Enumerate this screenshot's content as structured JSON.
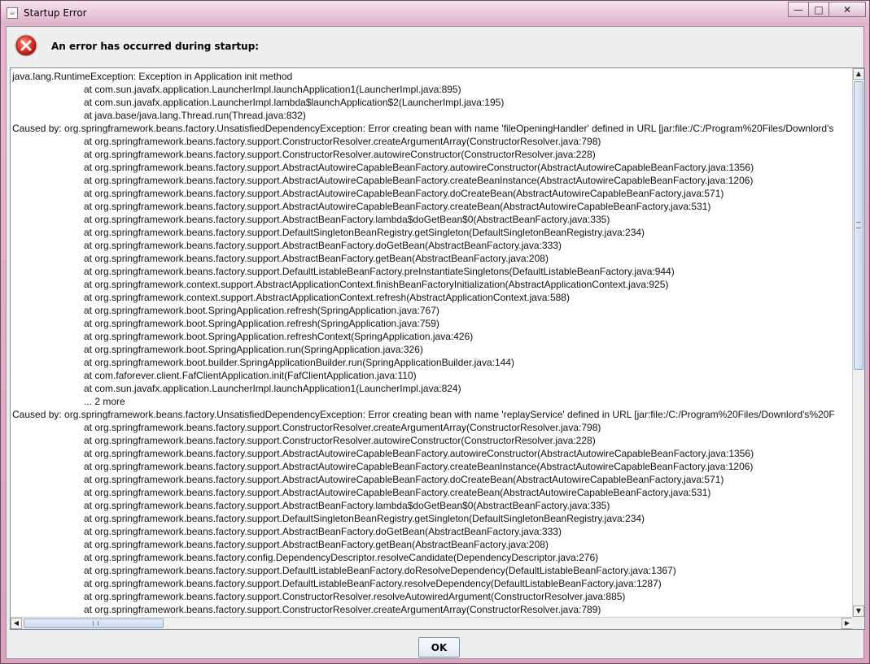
{
  "window": {
    "title": "Startup Error",
    "minimize_label": "—",
    "maximize_label": "□",
    "close_label": "✕"
  },
  "dialog": {
    "message": "An error has occurred during startup:",
    "ok_label": "OK"
  },
  "stacktrace": [
    {
      "text": "java.lang.RuntimeException: Exception in Application init method",
      "indent": false
    },
    {
      "text": "at com.sun.javafx.application.LauncherImpl.launchApplication1(LauncherImpl.java:895)",
      "indent": true
    },
    {
      "text": "at com.sun.javafx.application.LauncherImpl.lambda$launchApplication$2(LauncherImpl.java:195)",
      "indent": true
    },
    {
      "text": "at java.base/java.lang.Thread.run(Thread.java:832)",
      "indent": true
    },
    {
      "text": "Caused by: org.springframework.beans.factory.UnsatisfiedDependencyException: Error creating bean with name 'fileOpeningHandler' defined in URL [jar:file:/C:/Program%20Files/Downlord's",
      "indent": false
    },
    {
      "text": "at org.springframework.beans.factory.support.ConstructorResolver.createArgumentArray(ConstructorResolver.java:798)",
      "indent": true
    },
    {
      "text": "at org.springframework.beans.factory.support.ConstructorResolver.autowireConstructor(ConstructorResolver.java:228)",
      "indent": true
    },
    {
      "text": "at org.springframework.beans.factory.support.AbstractAutowireCapableBeanFactory.autowireConstructor(AbstractAutowireCapableBeanFactory.java:1356)",
      "indent": true
    },
    {
      "text": "at org.springframework.beans.factory.support.AbstractAutowireCapableBeanFactory.createBeanInstance(AbstractAutowireCapableBeanFactory.java:1206)",
      "indent": true
    },
    {
      "text": "at org.springframework.beans.factory.support.AbstractAutowireCapableBeanFactory.doCreateBean(AbstractAutowireCapableBeanFactory.java:571)",
      "indent": true
    },
    {
      "text": "at org.springframework.beans.factory.support.AbstractAutowireCapableBeanFactory.createBean(AbstractAutowireCapableBeanFactory.java:531)",
      "indent": true
    },
    {
      "text": "at org.springframework.beans.factory.support.AbstractBeanFactory.lambda$doGetBean$0(AbstractBeanFactory.java:335)",
      "indent": true
    },
    {
      "text": "at org.springframework.beans.factory.support.DefaultSingletonBeanRegistry.getSingleton(DefaultSingletonBeanRegistry.java:234)",
      "indent": true
    },
    {
      "text": "at org.springframework.beans.factory.support.AbstractBeanFactory.doGetBean(AbstractBeanFactory.java:333)",
      "indent": true
    },
    {
      "text": "at org.springframework.beans.factory.support.AbstractBeanFactory.getBean(AbstractBeanFactory.java:208)",
      "indent": true
    },
    {
      "text": "at org.springframework.beans.factory.support.DefaultListableBeanFactory.preInstantiateSingletons(DefaultListableBeanFactory.java:944)",
      "indent": true
    },
    {
      "text": "at org.springframework.context.support.AbstractApplicationContext.finishBeanFactoryInitialization(AbstractApplicationContext.java:925)",
      "indent": true
    },
    {
      "text": "at org.springframework.context.support.AbstractApplicationContext.refresh(AbstractApplicationContext.java:588)",
      "indent": true
    },
    {
      "text": "at org.springframework.boot.SpringApplication.refresh(SpringApplication.java:767)",
      "indent": true
    },
    {
      "text": "at org.springframework.boot.SpringApplication.refresh(SpringApplication.java:759)",
      "indent": true
    },
    {
      "text": "at org.springframework.boot.SpringApplication.refreshContext(SpringApplication.java:426)",
      "indent": true
    },
    {
      "text": "at org.springframework.boot.SpringApplication.run(SpringApplication.java:326)",
      "indent": true
    },
    {
      "text": "at org.springframework.boot.builder.SpringApplicationBuilder.run(SpringApplicationBuilder.java:144)",
      "indent": true
    },
    {
      "text": "at com.faforever.client.FafClientApplication.init(FafClientApplication.java:110)",
      "indent": true
    },
    {
      "text": "at com.sun.javafx.application.LauncherImpl.launchApplication1(LauncherImpl.java:824)",
      "indent": true
    },
    {
      "text": "... 2 more",
      "indent": true
    },
    {
      "text": "Caused by: org.springframework.beans.factory.UnsatisfiedDependencyException: Error creating bean with name 'replayService' defined in URL [jar:file:/C:/Program%20Files/Downlord's%20F",
      "indent": false
    },
    {
      "text": "at org.springframework.beans.factory.support.ConstructorResolver.createArgumentArray(ConstructorResolver.java:798)",
      "indent": true
    },
    {
      "text": "at org.springframework.beans.factory.support.ConstructorResolver.autowireConstructor(ConstructorResolver.java:228)",
      "indent": true
    },
    {
      "text": "at org.springframework.beans.factory.support.AbstractAutowireCapableBeanFactory.autowireConstructor(AbstractAutowireCapableBeanFactory.java:1356)",
      "indent": true
    },
    {
      "text": "at org.springframework.beans.factory.support.AbstractAutowireCapableBeanFactory.createBeanInstance(AbstractAutowireCapableBeanFactory.java:1206)",
      "indent": true
    },
    {
      "text": "at org.springframework.beans.factory.support.AbstractAutowireCapableBeanFactory.doCreateBean(AbstractAutowireCapableBeanFactory.java:571)",
      "indent": true
    },
    {
      "text": "at org.springframework.beans.factory.support.AbstractAutowireCapableBeanFactory.createBean(AbstractAutowireCapableBeanFactory.java:531)",
      "indent": true
    },
    {
      "text": "at org.springframework.beans.factory.support.AbstractBeanFactory.lambda$doGetBean$0(AbstractBeanFactory.java:335)",
      "indent": true
    },
    {
      "text": "at org.springframework.beans.factory.support.DefaultSingletonBeanRegistry.getSingleton(DefaultSingletonBeanRegistry.java:234)",
      "indent": true
    },
    {
      "text": "at org.springframework.beans.factory.support.AbstractBeanFactory.doGetBean(AbstractBeanFactory.java:333)",
      "indent": true
    },
    {
      "text": "at org.springframework.beans.factory.support.AbstractBeanFactory.getBean(AbstractBeanFactory.java:208)",
      "indent": true
    },
    {
      "text": "at org.springframework.beans.factory.config.DependencyDescriptor.resolveCandidate(DependencyDescriptor.java:276)",
      "indent": true
    },
    {
      "text": "at org.springframework.beans.factory.support.DefaultListableBeanFactory.doResolveDependency(DefaultListableBeanFactory.java:1367)",
      "indent": true
    },
    {
      "text": "at org.springframework.beans.factory.support.DefaultListableBeanFactory.resolveDependency(DefaultListableBeanFactory.java:1287)",
      "indent": true
    },
    {
      "text": "at org.springframework.beans.factory.support.ConstructorResolver.resolveAutowiredArgument(ConstructorResolver.java:885)",
      "indent": true
    },
    {
      "text": "at org.springframework.beans.factory.support.ConstructorResolver.createArgumentArray(ConstructorResolver.java:789)",
      "indent": true
    }
  ],
  "icons": {
    "app": "java-cup-icon",
    "error": "error-x-icon",
    "scroll_up": "▲",
    "scroll_down": "▼",
    "scroll_left": "◀",
    "scroll_right": "▶"
  },
  "colors": {
    "error_red": "#d9342b",
    "frame_pink": "#e9c4d8",
    "dialog_bg": "#eeeeee"
  }
}
